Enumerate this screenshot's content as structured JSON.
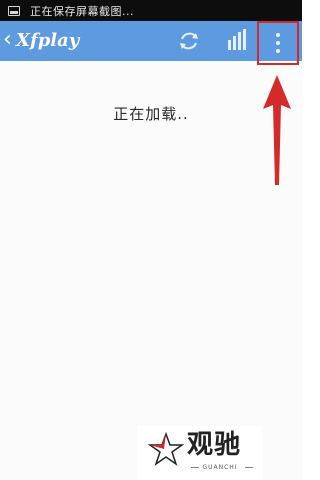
{
  "status_bar": {
    "text": "正在保存屏幕截图...",
    "icon": "screenshot-icon"
  },
  "action_bar": {
    "back_icon": "chevron-left-icon",
    "title": "Xfplay",
    "refresh_icon": "refresh-icon",
    "stats_icon": "bars-icon",
    "overflow_icon": "more-vertical-icon",
    "color": "#5d9ae0"
  },
  "content": {
    "loading_text": "正在加载.."
  },
  "annotation": {
    "arrow_color": "#d42a2a",
    "highlight_color": "#d42a2a"
  },
  "watermark": {
    "cn_text": "观驰",
    "en_text": "GUANCHI"
  }
}
